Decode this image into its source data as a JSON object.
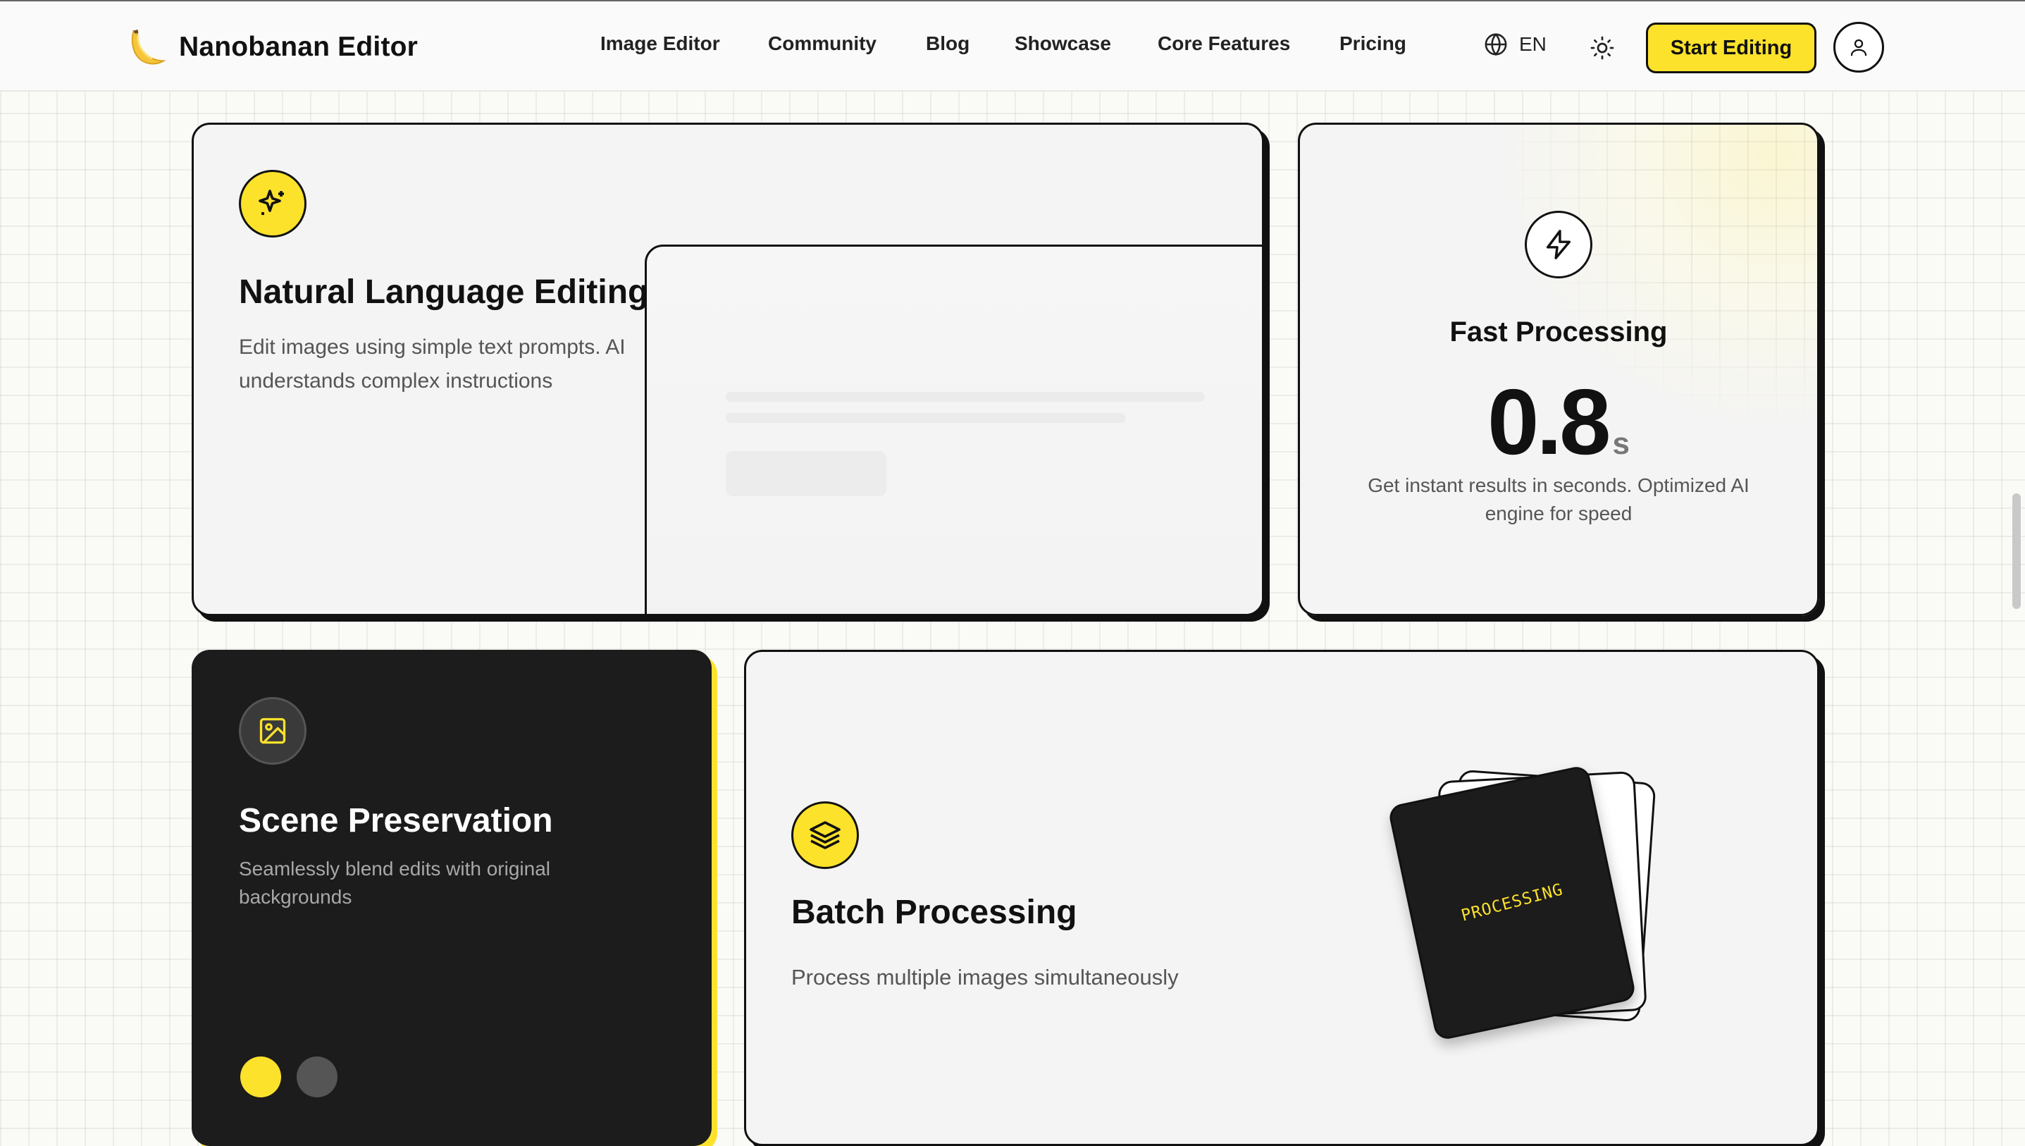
{
  "brand": {
    "name": "Nanobanan Editor",
    "logo_icon": "banana-icon"
  },
  "nav": [
    {
      "label": "Image Editor"
    },
    {
      "label": "Community"
    },
    {
      "label": "Blog"
    },
    {
      "label": "Showcase"
    },
    {
      "label": "Core Features"
    },
    {
      "label": "Pricing"
    }
  ],
  "header": {
    "language": "EN",
    "language_icon": "globe-icon",
    "theme_icon": "sun-icon",
    "cta_label": "Start Editing",
    "user_icon": "user-icon"
  },
  "colors": {
    "accent": "#fde22b",
    "dark": "#1c1c1c",
    "border": "#111111",
    "card_bg": "#f4f4f4"
  },
  "features": {
    "nle": {
      "icon": "sparkles-icon",
      "title": "Natural Language Editing",
      "desc_line1": "Edit images using simple text prompts. AI",
      "desc_line2": "understands complex instructions"
    },
    "fast": {
      "icon": "lightning-icon",
      "title": "Fast Processing",
      "value": "0.8",
      "unit": "s",
      "desc_line1": "Get instant results in seconds. Optimized AI",
      "desc_line2": "engine for speed"
    },
    "scene": {
      "icon": "image-icon",
      "title": "Scene Preservation",
      "desc_line1": "Seamlessly blend edits with original",
      "desc_line2": "backgrounds"
    },
    "batch": {
      "icon": "layers-icon",
      "title": "Batch Processing",
      "desc": "Process multiple images simultaneously",
      "stack_label": "PROCESSING"
    }
  }
}
